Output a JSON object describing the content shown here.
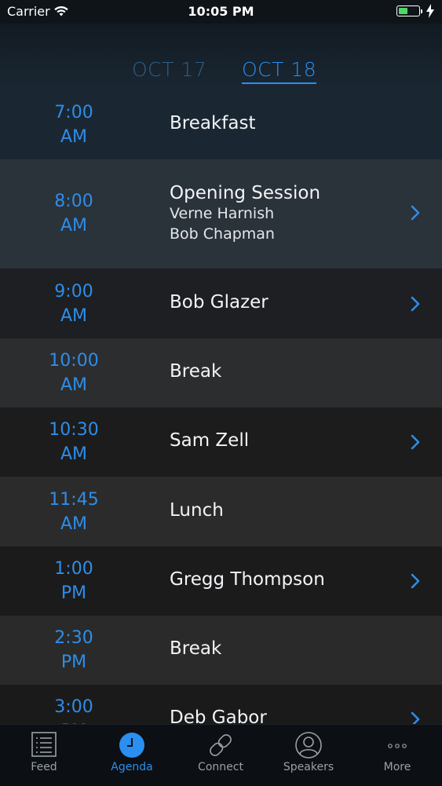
{
  "status_bar": {
    "carrier": "Carrier",
    "time": "10:05 PM"
  },
  "date_tabs": [
    {
      "label": "OCT 17",
      "active": false
    },
    {
      "label": "OCT 18",
      "active": true
    }
  ],
  "agenda": [
    {
      "time_line1": "7:00",
      "time_line2": "AM",
      "title": "Breakfast",
      "speakers": [],
      "has_detail": false
    },
    {
      "time_line1": "8:00",
      "time_line2": "AM",
      "title": "Opening Session",
      "speakers": [
        "Verne Harnish",
        "Bob Chapman"
      ],
      "has_detail": true
    },
    {
      "time_line1": "9:00",
      "time_line2": "AM",
      "title": "Bob Glazer",
      "speakers": [],
      "has_detail": true
    },
    {
      "time_line1": "10:00",
      "time_line2": "AM",
      "title": "Break",
      "speakers": [],
      "has_detail": false
    },
    {
      "time_line1": "10:30",
      "time_line2": "AM",
      "title": "Sam Zell",
      "speakers": [],
      "has_detail": true
    },
    {
      "time_line1": "11:45",
      "time_line2": "AM",
      "title": "Lunch",
      "speakers": [],
      "has_detail": false
    },
    {
      "time_line1": "1:00",
      "time_line2": "PM",
      "title": "Gregg Thompson",
      "speakers": [],
      "has_detail": true
    },
    {
      "time_line1": "2:30",
      "time_line2": "PM",
      "title": "Break",
      "speakers": [],
      "has_detail": false
    },
    {
      "time_line1": "3:00",
      "time_line2": "PM",
      "title": "Deb Gabor",
      "speakers": [],
      "has_detail": true
    }
  ],
  "tab_bar": [
    {
      "label": "Feed",
      "icon": "list-icon",
      "active": false
    },
    {
      "label": "Agenda",
      "icon": "clock-icon",
      "active": true
    },
    {
      "label": "Connect",
      "icon": "link-icon",
      "active": false
    },
    {
      "label": "Speakers",
      "icon": "person-icon",
      "active": false
    },
    {
      "label": "More",
      "icon": "more-icon",
      "active": false
    }
  ],
  "colors": {
    "accent": "#2a8ff0",
    "background": "#141a21"
  }
}
